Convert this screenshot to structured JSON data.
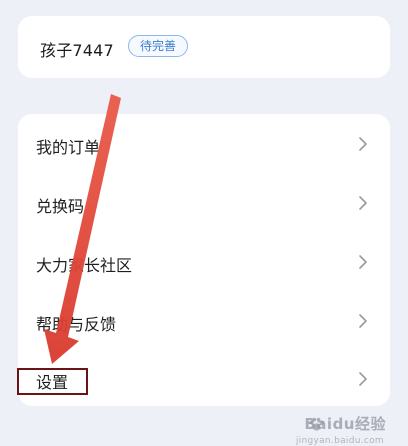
{
  "profile": {
    "name": "孩子7447",
    "badge": "待完善"
  },
  "menu": {
    "items": [
      {
        "label": "我的订单",
        "icon": "chevron-right-icon"
      },
      {
        "label": "兑换码",
        "icon": "chevron-right-icon"
      },
      {
        "label": "大力家长社区",
        "icon": "chevron-right-icon"
      },
      {
        "label": "帮助与反馈",
        "icon": "chevron-right-icon"
      },
      {
        "label": "设置",
        "icon": "chevron-right-icon"
      }
    ]
  },
  "watermark": {
    "text": "Baidu经验",
    "sub": "jingyan.baidu.com"
  },
  "colors": {
    "background": "#eef0f8",
    "card": "#ffffff",
    "badge_text": "#3a7ed0",
    "badge_border": "#8fb6e6",
    "annotation_arrow": "#e0463a",
    "highlight_box": "#6a1418"
  }
}
